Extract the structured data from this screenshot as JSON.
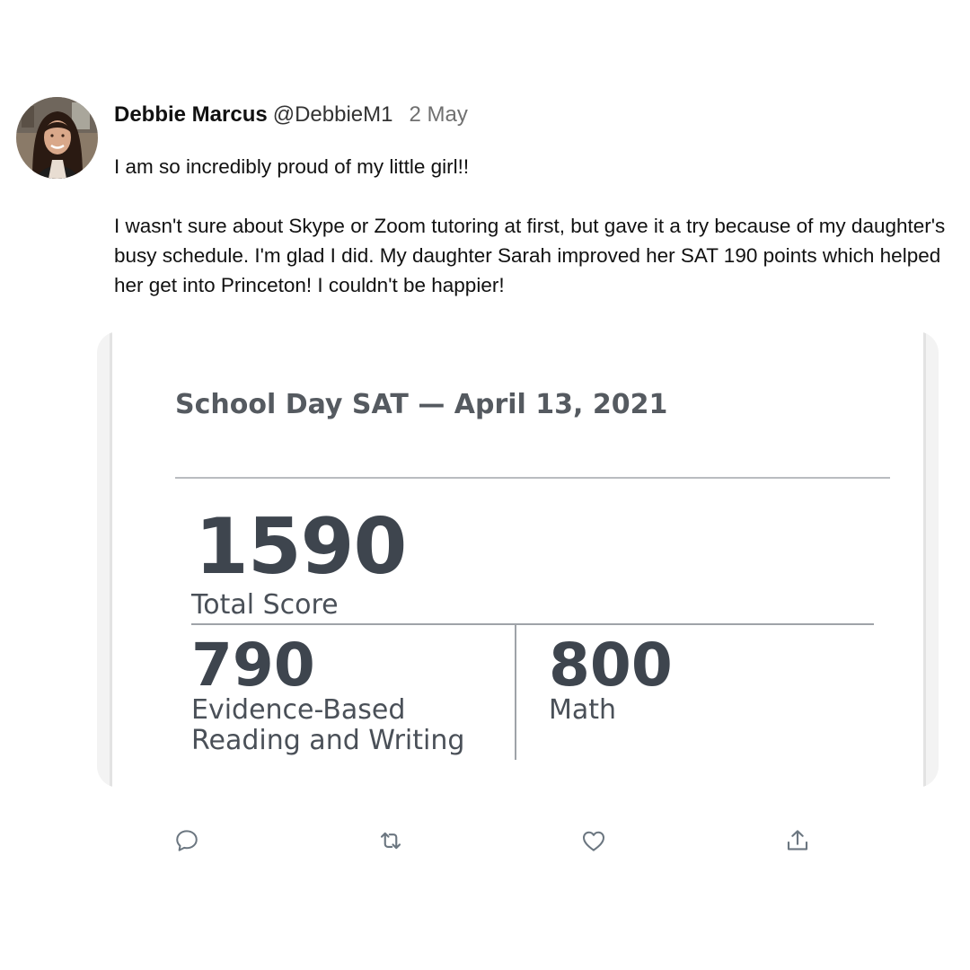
{
  "author": {
    "display_name": "Debbie Marcus",
    "handle": "@DebbieM1",
    "timestamp": "2 May",
    "avatar_icon": "profile-photo"
  },
  "tweet": {
    "paragraphs": [
      "I am so incredibly proud of my little girl!!",
      "I wasn't sure about Skype or Zoom tutoring at first, but gave it a try because of my daughter's busy schedule. I'm glad I did. My daughter Sarah improved her SAT 190 points which helped her get into Princeton! I couldn't be happier!"
    ]
  },
  "score_report": {
    "title": "School Day SAT — April 13, 2021",
    "total_score": "1590",
    "total_label": "Total Score",
    "ebrw_score": "790",
    "ebrw_label": "Evidence-Based Reading and Writing",
    "math_score": "800",
    "math_label": "Math"
  },
  "actions": {
    "icons": [
      "reply-icon",
      "retweet-icon",
      "like-icon",
      "share-icon"
    ]
  },
  "colors": {
    "icon_gray": "#6b7680",
    "score_text": "#3e454e",
    "timestamp": "#707070"
  }
}
